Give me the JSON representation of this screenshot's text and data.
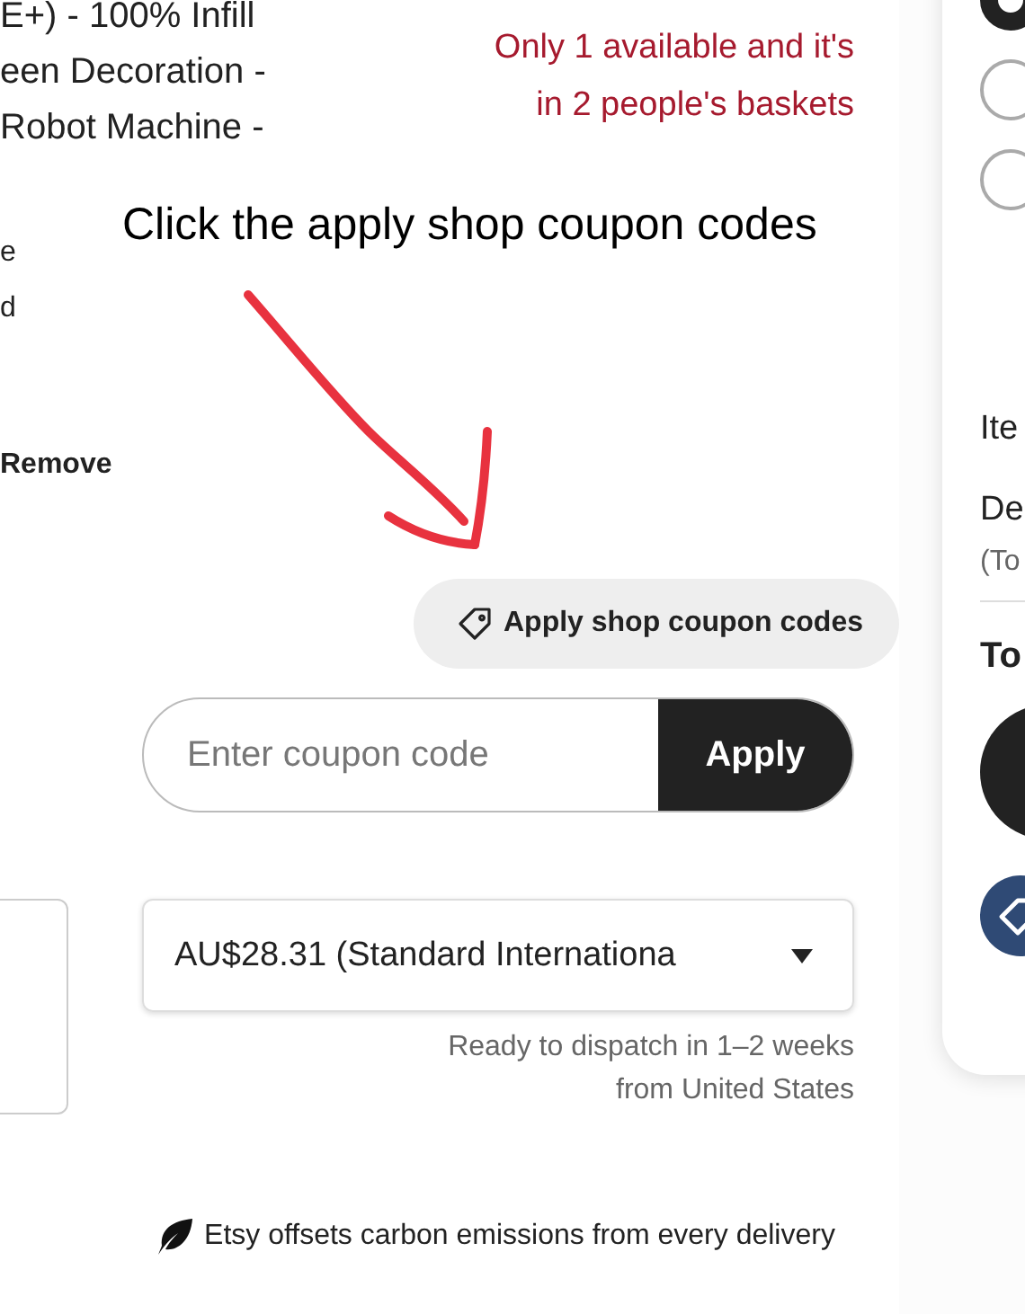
{
  "listing": {
    "title_lines": [
      "E+) - 100% Infill",
      "een Decoration -",
      "Robot Machine -"
    ],
    "detail_lines": [
      "e",
      "d"
    ],
    "remove_link": "Remove",
    "stock_note": [
      "Only 1 available and it's",
      "in 2 people's baskets"
    ]
  },
  "annotation": {
    "text": "Click the apply shop coupon codes"
  },
  "coupon_button": {
    "label": "Apply shop coupon codes"
  },
  "coupon_field": {
    "placeholder": "Enter coupon code",
    "button": "Apply"
  },
  "shipping": {
    "value": "AU$28.31 (Standard Internationa",
    "dispatch": [
      "Ready to dispatch in 1–2 weeks",
      "from United States"
    ]
  },
  "carbon_note": "Etsy offsets carbon emissions from every delivery",
  "summary": {
    "payment_options": [
      {
        "selected": true
      },
      {
        "selected": false
      },
      {
        "selected": false
      }
    ],
    "rows": [
      {
        "kind": "label",
        "text": "Ite"
      },
      {
        "kind": "label",
        "text": "De"
      },
      {
        "kind": "note",
        "text": "(To"
      },
      {
        "kind": "divider"
      },
      {
        "kind": "total",
        "text": "To"
      }
    ]
  }
}
